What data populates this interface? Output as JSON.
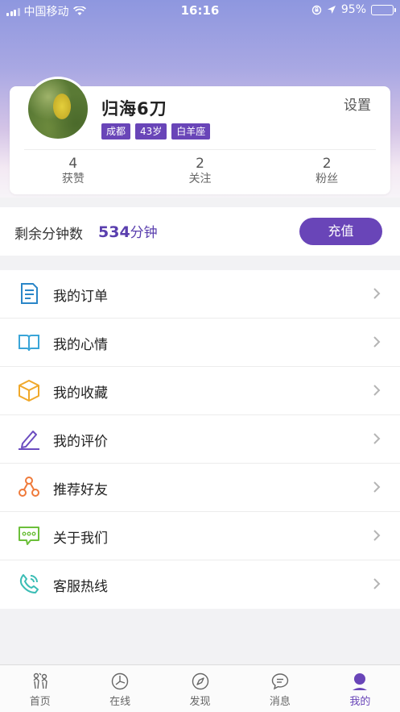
{
  "status_bar": {
    "carrier": "中国移动",
    "time": "16:16",
    "battery": "95%"
  },
  "profile": {
    "name": "归海6刀",
    "settings_label": "设置",
    "tags": [
      "成都",
      "43岁",
      "白羊座"
    ],
    "stats": [
      {
        "value": "4",
        "label": "获赞"
      },
      {
        "value": "2",
        "label": "关注"
      },
      {
        "value": "2",
        "label": "粉丝"
      }
    ]
  },
  "minutes": {
    "label": "剩余分钟数",
    "value": "534",
    "unit": "分钟",
    "recharge_label": "充值"
  },
  "menu": {
    "items": [
      {
        "label": "我的订单",
        "icon": "order-icon"
      },
      {
        "label": "我的心情",
        "icon": "book-icon"
      },
      {
        "label": "我的收藏",
        "icon": "box-icon"
      },
      {
        "label": "我的评价",
        "icon": "pencil-icon"
      },
      {
        "label": "推荐好友",
        "icon": "share-icon"
      },
      {
        "label": "关于我们",
        "icon": "chat-bubble-icon"
      },
      {
        "label": "客服热线",
        "icon": "phone-icon"
      }
    ]
  },
  "tabbar": {
    "items": [
      {
        "label": "首页",
        "icon": "home-icon",
        "active": false
      },
      {
        "label": "在线",
        "icon": "online-icon",
        "active": false
      },
      {
        "label": "发现",
        "icon": "compass-icon",
        "active": false
      },
      {
        "label": "消息",
        "icon": "message-icon",
        "active": false
      },
      {
        "label": "我的",
        "icon": "user-icon",
        "active": true
      }
    ]
  },
  "colors": {
    "accent": "#6945b8",
    "order_icon": "#2a86c8",
    "book_icon": "#3aa5d8",
    "box_icon": "#f0a82a",
    "pencil_icon": "#6b4cc0",
    "share_icon": "#ef7a3a",
    "chat_icon": "#6cbf3a",
    "phone_icon": "#3bbdb5"
  }
}
